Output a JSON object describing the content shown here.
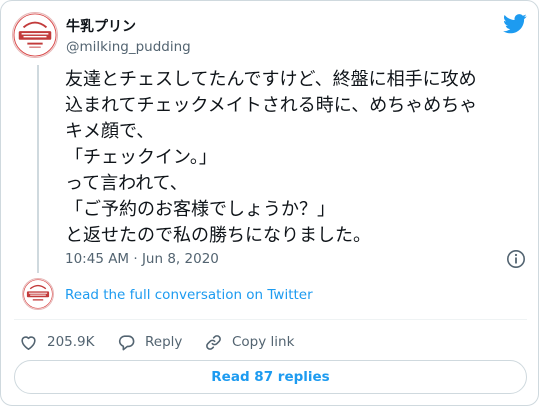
{
  "author": {
    "display_name": "牛乳プリン",
    "handle": "@milking_pudding",
    "avatar_text": "牛乳プリン"
  },
  "tweet": {
    "text": "友達とチェスしてたんですけど、終盤に相手に攻め\n込まれてチェックメイトされる時に、めちゃめちゃ\nキメ顔で、\n「チェックイン。」\nって言われて、\n「ご予約のお客様でしょうか？」\nと返せたので私の勝ちになりました。",
    "timestamp": "10:45 AM · Jun 8, 2020"
  },
  "links": {
    "read_full": "Read the full conversation on Twitter"
  },
  "actions": {
    "like_count": "205.9K",
    "reply_label": "Reply",
    "copy_label": "Copy link"
  },
  "replies": {
    "label": "Read 87 replies"
  },
  "icons": {
    "brand": "twitter-bird-icon",
    "info": "info-icon",
    "like": "heart-icon",
    "reply": "reply-bubble-icon",
    "copy": "link-icon"
  },
  "colors": {
    "accent": "#1d9bf0",
    "text": "#0f1419",
    "muted": "#536471",
    "border": "#cfd9de"
  }
}
